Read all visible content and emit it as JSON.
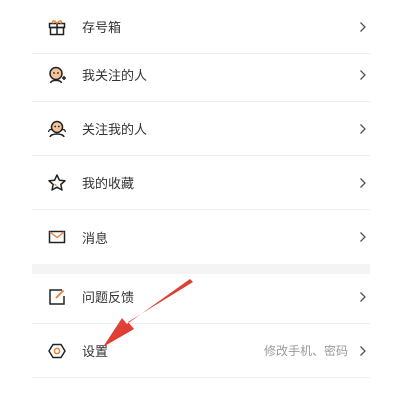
{
  "menu": {
    "items": [
      {
        "label": "存号箱",
        "icon": "gift-icon"
      },
      {
        "label": "我关注的人",
        "icon": "user-plus-icon"
      },
      {
        "label": "关注我的人",
        "icon": "user-group-icon"
      },
      {
        "label": "我的收藏",
        "icon": "star-icon"
      },
      {
        "label": "消息",
        "icon": "mail-icon"
      },
      {
        "label": "问题反馈",
        "icon": "edit-icon"
      },
      {
        "label": "设置",
        "icon": "settings-icon",
        "hint": "修改手机、密码"
      }
    ]
  },
  "colors": {
    "accent": "#e8813c",
    "icon_dark": "#222222",
    "annotation_arrow": "#e83a2f"
  }
}
